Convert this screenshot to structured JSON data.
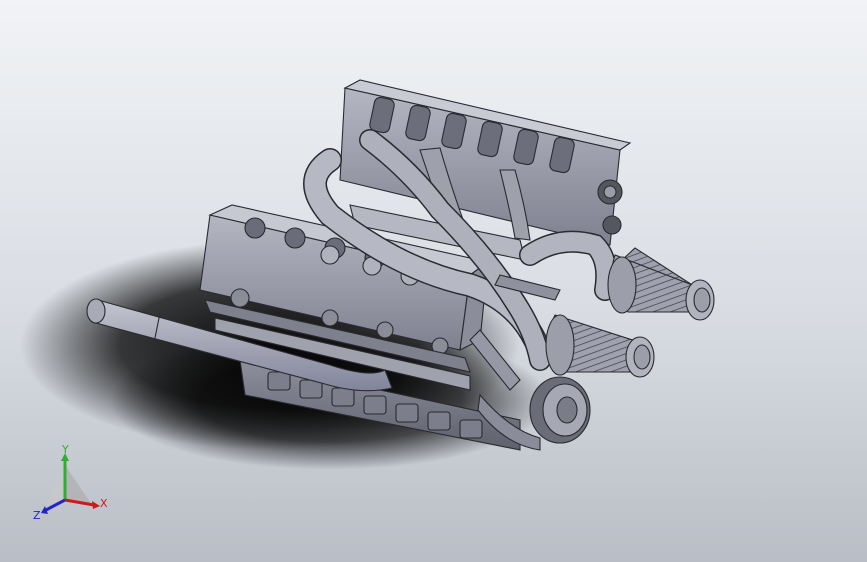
{
  "viewport": {
    "background_top": "#f1f3f6",
    "background_bottom": "#b9bec6",
    "model_fill": "#9a9caa",
    "model_edge": "#2a2a30"
  },
  "triad": {
    "x_label": "X",
    "y_label": "Y",
    "z_label": "Z",
    "x_color": "#cc1a1a",
    "y_color": "#2fae2f",
    "z_color": "#2323c8"
  }
}
